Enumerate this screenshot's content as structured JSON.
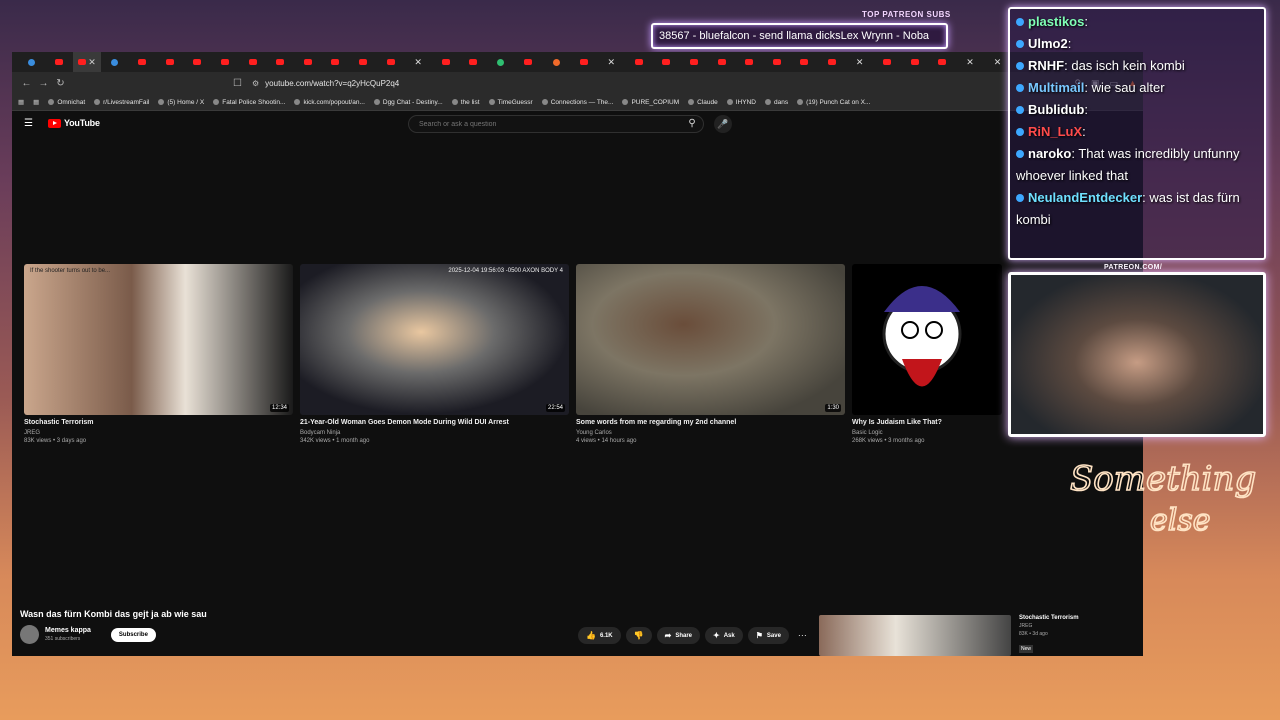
{
  "overlay": {
    "patreon_label": "TOP PATREON SUBS",
    "ticker_text": "38567 - bluefalcon - send llama dicksLex Wrynn - Noba",
    "patreon_url": "PATREON.COM/"
  },
  "browser": {
    "url": "youtube.com/watch?v=q2yHcQuP2q4",
    "tab_count": 36,
    "bookmarks": [
      "Omnichat",
      "r/LivestreamFail",
      "(5) Home / X",
      "Fatal Police Shootin...",
      "kick.com/popout/an...",
      "Dgg Chat - Destiny...",
      "the list",
      "TimeGuessr",
      "Connections — The...",
      "PURE_COPIUM",
      "Claude",
      "IHYND",
      "dans",
      "(19) Punch Cat on X..."
    ]
  },
  "youtube": {
    "logo": "YouTube",
    "search_placeholder": "Search or ask a question",
    "videos": [
      {
        "title": "Stochastic Terrorism",
        "channel": "JREG",
        "meta": "83K views • 3 days ago",
        "duration": "12:34",
        "caption": "If the shooter turns out to be..."
      },
      {
        "title": "21-Year-Old Woman Goes Demon Mode During Wild DUI Arrest",
        "channel": "Bodycam Ninja",
        "meta": "342K views • 1 month ago",
        "duration": "22:54",
        "caption": "2025-12-04 19:56:03 -0500 AXON BODY 4"
      },
      {
        "title": "Some words from me regarding my 2nd channel",
        "channel": "Young Carlos",
        "meta": "4 views • 14 hours ago",
        "duration": "1:30",
        "caption": ""
      },
      {
        "title": "Why Is Judaism Like That?",
        "channel": "Basic Logic",
        "meta": "268K views • 3 months ago",
        "duration": "",
        "caption": ""
      }
    ],
    "watch": {
      "title": "Wasn das fürn Kombi das gejt ja ab wie sau",
      "channel": "Memes kappa",
      "subs": "351 subscribers",
      "subscribe": "Subscribe",
      "likes": "6.1K",
      "share": "Share",
      "ask": "Ask",
      "save": "Save"
    },
    "up_next": {
      "title": "Stochastic Terrorism",
      "channel": "JREG",
      "meta": "83K • 3d ago",
      "badge": "New"
    }
  },
  "chat": [
    {
      "user": "plastikos",
      "msg": "",
      "color": "u-green"
    },
    {
      "user": "Ulmo2",
      "msg": "",
      "color": "u-white"
    },
    {
      "user": "RNHF",
      "msg": "das isch kein kombi",
      "color": "u-white"
    },
    {
      "user": "Multimail",
      "msg": "wie sau alter",
      "color": "u-blue"
    },
    {
      "user": "Bublidub",
      "msg": "",
      "color": "u-white"
    },
    {
      "user": "RiN_LuX",
      "msg": "",
      "color": "u-red"
    },
    {
      "user": "naroko",
      "msg": "That was incredibly unfunny whoever linked that",
      "color": "u-white"
    },
    {
      "user": "NeulandEntdecker",
      "msg": "was ist das fürn kombi",
      "color": "u-cyan"
    }
  ],
  "neon_sign": "Something else"
}
